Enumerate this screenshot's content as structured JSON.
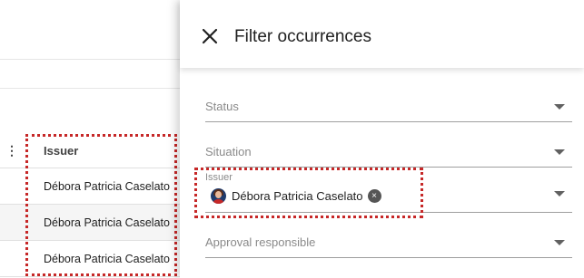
{
  "table": {
    "menu_icon": "⋮",
    "issuer_header": "Issuer",
    "rows": [
      {
        "issuer": "Débora Patricia Caselato"
      },
      {
        "issuer": "Débora Patricia Caselato"
      },
      {
        "issuer": "Débora Patricia Caselato"
      }
    ]
  },
  "drawer": {
    "title": "Filter occurrences",
    "close_icon": "close-icon",
    "fields": {
      "status": {
        "placeholder": "Status"
      },
      "situation": {
        "placeholder": "Situation"
      },
      "issuer": {
        "label": "Issuer",
        "chip_label": "Débora Patricia Caselato",
        "chip_remove": "×"
      },
      "approval": {
        "placeholder": "Approval responsible"
      }
    }
  },
  "colors": {
    "highlight": "#c62828",
    "row_shade": "#f5f5f5"
  }
}
